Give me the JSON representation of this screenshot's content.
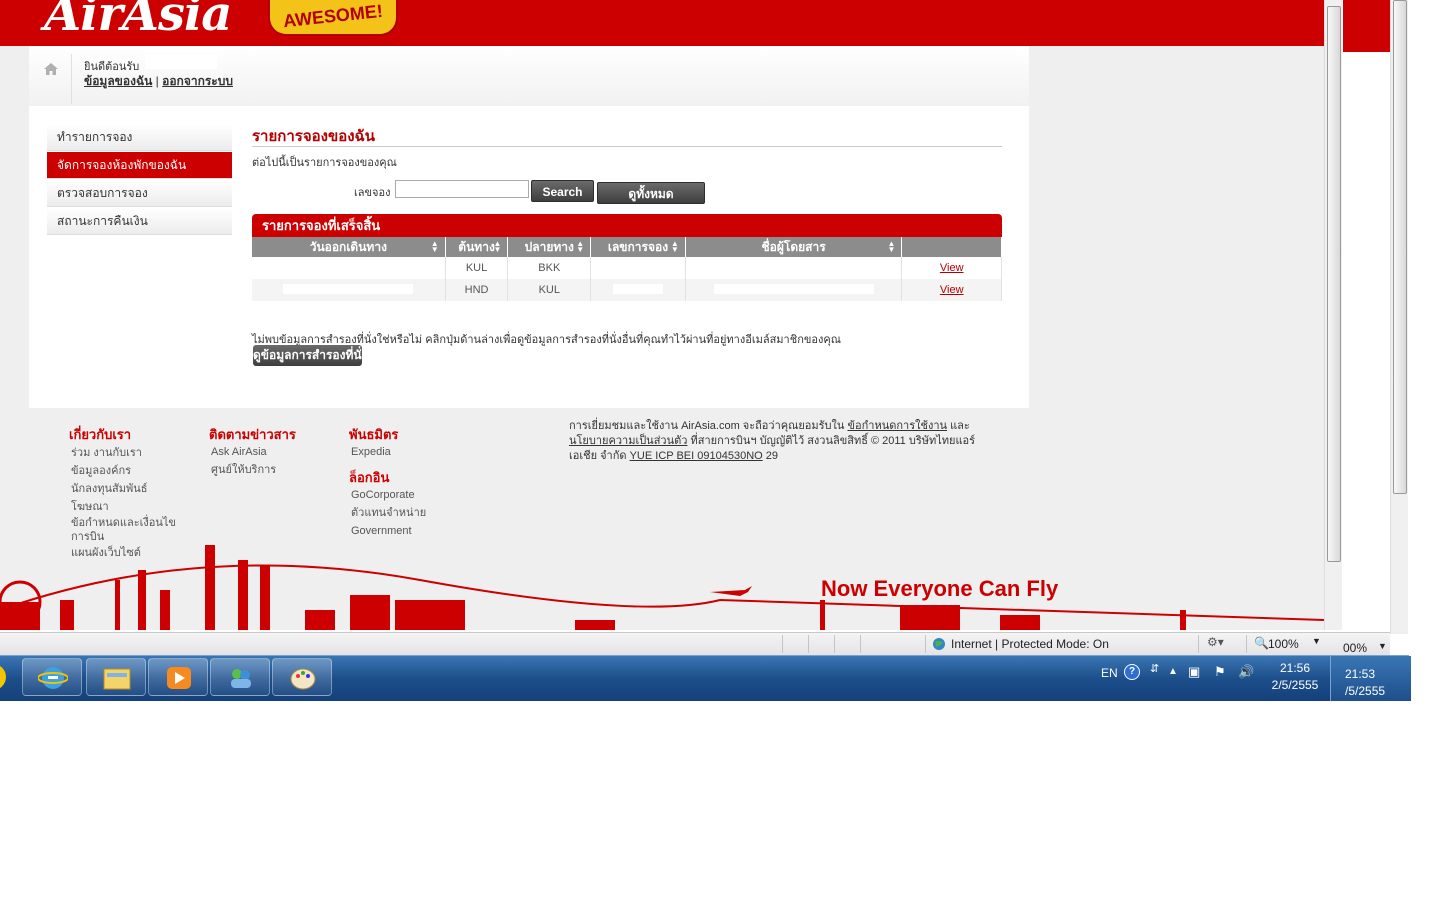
{
  "brand": {
    "logo": "AirAsia",
    "badge": "AWESOME!"
  },
  "user": {
    "welcome": "ยินดีต้อนรับ",
    "my_info": "ข้อมูลของฉัน",
    "sep": "|",
    "logout": "ออกจากระบบ"
  },
  "nav": {
    "items": [
      "ทำรายการจอง",
      "จัดการจองห้องพักของฉัน",
      "ตรวจสอบการจอง",
      "สถานะการคืนเงิน"
    ]
  },
  "main": {
    "title": "รายการจองของฉัน",
    "subtitle": "ต่อไปนี้เป็นรายการจองของคุณ",
    "search_label": "เลขจอง",
    "search_value": "",
    "search_button": "Search",
    "show_all_button": "ดูทั้งหมด"
  },
  "table": {
    "title": "รายการจองที่เสร็จสิ้น",
    "headers": [
      "วันออกเดินทาง",
      "ต้นทาง",
      "ปลายทาง",
      "เลขการจอง",
      "ชื่อผู้โดยสาร",
      ""
    ],
    "rows": [
      {
        "origin": "KUL",
        "destination": "BKK",
        "action": "View"
      },
      {
        "origin": "HND",
        "destination": "KUL",
        "action": "View"
      }
    ]
  },
  "info": {
    "text": "ไม่พบข้อมูลการสำรองที่นั่งใช่หรือไม่ คลิกปุ่มด้านล่างเพื่อดูข้อมูลการสำรองที่นั่งอื่นที่คุณทำไว้ผ่านที่อยู่ทางอีเมล์สมาชิกของคุณ",
    "button": "ดูข้อมูลการสำรองที่นั่ง"
  },
  "footer": {
    "about": {
      "title": "เกี่ยวกับเรา",
      "items": [
        "ร่วม งานกับเรา",
        "ข้อมูลองค์กร",
        "นักลงทุนสัมพันธ์",
        "โฆษณา",
        "ข้อกำหนดและเงื่อนไข",
        "การบิน",
        "แผนผังเว็บไซต์"
      ]
    },
    "news": {
      "title": "ติดตามข่าวสาร",
      "items": [
        "Ask AirAsia",
        "ศูนย์ให้บริการ"
      ]
    },
    "partners": {
      "title": "พันธมิตร",
      "items": [
        "Expedia"
      ]
    },
    "login": {
      "title": "ล็อกอิน",
      "items": [
        "GoCorporate",
        "ตัวแทนจำหน่าย",
        "Government"
      ]
    },
    "legal": {
      "p1": "การเยี่ยมชมและใช้งาน AirAsia.com จะถือว่าคุณยอมรับใน",
      "terms": "ข้อกำหนดการใช้งาน",
      "and": "และ",
      "privacy": "นโยบายความเป็นส่วนตัว",
      "p2": "ที่สายการบินฯ บัญญัติไว้ สงวนลิขสิทธิ์ © 2011 บริษัทไทยแอร์เอเชีย จำกัด",
      "icp": "YUE ICP BEI 09104530NO",
      "p3": "29"
    },
    "slogan": "Now Everyone Can Fly"
  },
  "statusbar": {
    "zone": "Internet | Protected Mode: On",
    "zoom": "100%",
    "zoom2": "00%"
  },
  "taskbar": {
    "lang": "EN",
    "time1": "21:56",
    "date1": "2/5/2555",
    "time2": "21:53",
    "date2": "/5/2555"
  },
  "colors": {
    "brand_red": "#cc0000",
    "dark_red": "#b30000",
    "taskbar_blue": "#1d4f8c"
  }
}
